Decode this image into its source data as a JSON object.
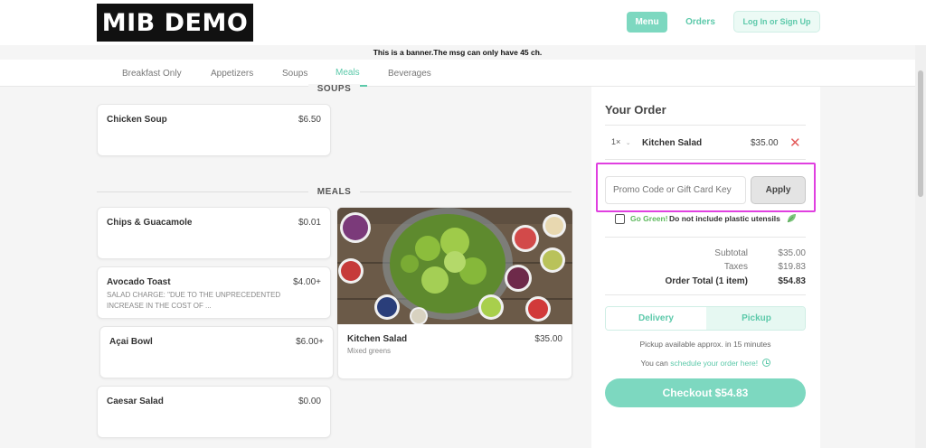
{
  "header": {
    "logo": "MIB DEMO",
    "nav_menu": "Menu",
    "nav_orders": "Orders",
    "nav_login": "Log In or Sign Up"
  },
  "banner": "This is a banner.The msg can only have 45 ch.",
  "categories": [
    {
      "label": "Breakfast Only",
      "active": false
    },
    {
      "label": "Appetizers",
      "active": false
    },
    {
      "label": "Soups",
      "active": false
    },
    {
      "label": "Meals",
      "active": true
    },
    {
      "label": "Beverages",
      "active": false
    }
  ],
  "sections": {
    "soups": {
      "title": "SOUPS",
      "items": [
        {
          "name": "Chicken Soup",
          "price": "$6.50"
        }
      ]
    },
    "meals": {
      "title": "MEALS",
      "items": [
        {
          "name": "Chips & Guacamole",
          "price": "$0.01",
          "desc": ""
        },
        {
          "name": "Avocado Toast",
          "price": "$4.00+",
          "desc": "SALAD CHARGE: \"DUE TO THE UNPRECEDENTED INCREASE IN THE COST OF ..."
        },
        {
          "name": "Açai Bowl",
          "price": "$6.00+",
          "desc": ""
        },
        {
          "name": "Caesar Salad",
          "price": "$0.00",
          "desc": ""
        },
        {
          "name": "Kitchen Salad",
          "price": "$35.00",
          "desc": "Mixed greens"
        }
      ]
    }
  },
  "order": {
    "title": "Your Order",
    "item": {
      "qty": "1×",
      "name": "Kitchen Salad",
      "price": "$35.00"
    },
    "promo_placeholder": "Promo Code or Gift Card Key",
    "apply_label": "Apply",
    "go_green_label": "Go Green!",
    "go_green_text": "Do not include plastic utensils",
    "summary": [
      {
        "label": "Subtotal",
        "value": "$35.00"
      },
      {
        "label": "Taxes",
        "value": "$19.83"
      },
      {
        "label": "Order Total (1 item)",
        "value": "$54.83"
      }
    ],
    "delivery_label": "Delivery",
    "pickup_label": "Pickup",
    "pickup_note": "Pickup available approx. in 15 minutes",
    "schedule_prefix": "You can",
    "schedule_link": "schedule your order here!",
    "checkout_label": "Checkout $54.83"
  },
  "colors": {
    "accent": "#7dd8c0",
    "accent_text": "#5cc9aa",
    "highlight": "#e040e0",
    "remove": "#e35b5b"
  },
  "icons": {
    "remove": "close-icon",
    "leaf": "leaf-icon",
    "clock": "clock-icon",
    "qty_dropdown": "chevron-down-icon"
  }
}
